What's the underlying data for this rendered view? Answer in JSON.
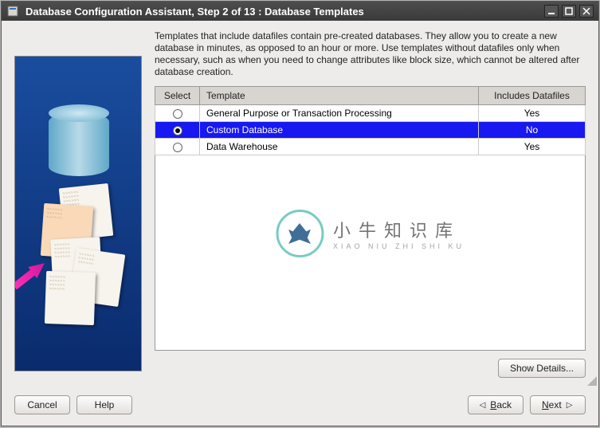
{
  "titlebar": {
    "title": "Database Configuration Assistant, Step 2 of 13 : Database Templates"
  },
  "instructions": "Templates that include datafiles contain pre-created databases. They allow you to create a new database in minutes, as opposed to an hour or more. Use templates without datafiles only when necessary, such as when you need to change attributes like block size, which cannot be altered after database creation.",
  "table": {
    "headers": {
      "select": "Select",
      "template": "Template",
      "includes": "Includes Datafiles"
    },
    "rows": [
      {
        "template": "General Purpose or Transaction Processing",
        "includes": "Yes",
        "selected": false
      },
      {
        "template": "Custom Database",
        "includes": "No",
        "selected": true
      },
      {
        "template": "Data Warehouse",
        "includes": "Yes",
        "selected": false
      }
    ]
  },
  "watermark": {
    "cn": "小牛知识库",
    "en": "XIAO NIU ZHI SHI KU"
  },
  "buttons": {
    "show_details": "Show Details...",
    "cancel": "Cancel",
    "help": "Help",
    "back": "Back",
    "next": "Next"
  }
}
